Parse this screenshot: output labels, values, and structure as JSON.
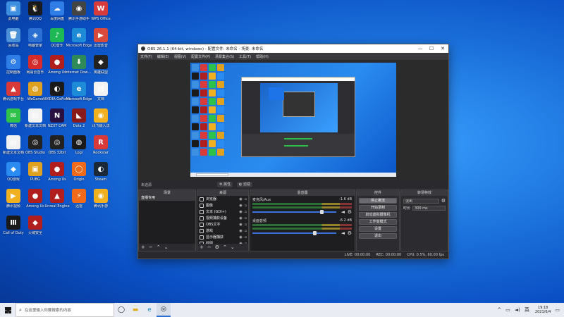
{
  "desktop": {
    "icons": [
      {
        "label": "此电脑",
        "color": "#3d8fe0",
        "glyph": "▣"
      },
      {
        "label": "腾讯QQ",
        "color": "#1a1a1a",
        "glyph": "🐧"
      },
      {
        "label": "百度网盘",
        "color": "#2f7ee8",
        "glyph": "☁"
      },
      {
        "label": "腾讯手游助手",
        "color": "#444",
        "glyph": "◉"
      },
      {
        "label": "WPS Office",
        "color": "#d83b3b",
        "glyph": "W"
      },
      {
        "label": "回收站",
        "color": "#4a90d9",
        "glyph": "🗑"
      },
      {
        "label": "电脑管家",
        "color": "#2a6fd1",
        "glyph": "◈"
      },
      {
        "label": "QQ音乐",
        "color": "#1db954",
        "glyph": "♪"
      },
      {
        "label": "Microsoft Edge",
        "color": "#1d8bd6",
        "glyph": "e"
      },
      {
        "label": "迅雷影音",
        "color": "#d84a3b",
        "glyph": "▶"
      },
      {
        "label": "控制面板",
        "color": "#2f7ee8",
        "glyph": "⚙"
      },
      {
        "label": "网易云音乐",
        "color": "#d62b2b",
        "glyph": "◎"
      },
      {
        "label": "Among Us",
        "color": "#b01e1e",
        "glyph": "●"
      },
      {
        "label": "Internet Download",
        "color": "#2e8b57",
        "glyph": "⬇"
      },
      {
        "label": "英雄联盟",
        "color": "#222",
        "glyph": "◆"
      },
      {
        "label": "腾讯游戏平台",
        "color": "#d83a3a",
        "glyph": "▲"
      },
      {
        "label": "WeGame",
        "color": "#e0a020",
        "glyph": "◍"
      },
      {
        "label": "NVIDIA GeForce",
        "color": "#1a1a1a",
        "glyph": "◐"
      },
      {
        "label": "Microsoft Edge",
        "color": "#1d8bd6",
        "glyph": "e"
      },
      {
        "label": "文档",
        "color": "#f2f2f2",
        "glyph": "▤"
      },
      {
        "label": "微信",
        "color": "#2ec24a",
        "glyph": "✉"
      },
      {
        "label": "新建文本文档",
        "color": "#f2f2f2",
        "glyph": "▤"
      },
      {
        "label": "NZXT CAM",
        "color": "#2a1040",
        "glyph": "N"
      },
      {
        "label": "Dota 2",
        "color": "#8a1a1a",
        "glyph": "◣"
      },
      {
        "label": "讯飞输入法",
        "color": "#f0b020",
        "glyph": "◉"
      },
      {
        "label": "新建文本文档",
        "color": "#f2f2f2",
        "glyph": "▤"
      },
      {
        "label": "OBS Studio",
        "color": "#222",
        "glyph": "◎"
      },
      {
        "label": "OBS 32bit",
        "color": "#222",
        "glyph": "◎"
      },
      {
        "label": "Logi",
        "color": "#1a1a1a",
        "glyph": "◍"
      },
      {
        "label": "Rockstar",
        "color": "#d83a3a",
        "glyph": "R"
      },
      {
        "label": "QQ游戏",
        "color": "#2a8cf0",
        "glyph": "◆"
      },
      {
        "label": "PUBG",
        "color": "#e0a020",
        "glyph": "▣"
      },
      {
        "label": "Among Us",
        "color": "#b01e1e",
        "glyph": "●"
      },
      {
        "label": "Origin",
        "color": "#f06a1a",
        "glyph": "◯"
      },
      {
        "label": "Steam",
        "color": "#1b2838",
        "glyph": "◐"
      },
      {
        "label": "腾讯视频",
        "color": "#f0b020",
        "glyph": "▶"
      },
      {
        "label": "Among Us",
        "color": "#b01e1e",
        "glyph": "●"
      },
      {
        "label": "Unreal Engine",
        "color": "#b01e1e",
        "glyph": "▲"
      },
      {
        "label": "迅雷",
        "color": "#f06a1a",
        "glyph": "⚡"
      },
      {
        "label": "腾讯手游",
        "color": "#f0b020",
        "glyph": "◉"
      },
      {
        "label": "Call of Duty",
        "color": "#1a1a1a",
        "glyph": "Ⅲ"
      },
      {
        "label": "火绒安全",
        "color": "#b01e1e",
        "glyph": "◆"
      }
    ]
  },
  "obs": {
    "title": "OBS 26.1.1 (64-bit, windows) - 配置文件: 未命名 - 场景: 未命名",
    "window_buttons": {
      "minimize": "—",
      "maximize": "☐",
      "close": "✕"
    },
    "menu": [
      "文件(F)",
      "编辑(E)",
      "视图(V)",
      "配置文件(P)",
      "场景集合(S)",
      "工具(T)",
      "帮助(H)"
    ],
    "no_source_label": "未选源",
    "preview_tabs": [
      "属性",
      "滤镜"
    ],
    "scenes": {
      "header": "场景",
      "items": [
        "直播专用"
      ]
    },
    "sources": {
      "header": "来源",
      "items": [
        "浏览器",
        "图像",
        "文本 (GDI+)",
        "视频捕获设备",
        "OBS文字",
        "游戏",
        "显示器捕获",
        "截图"
      ]
    },
    "mixer": {
      "header": "混音器",
      "channels": [
        {
          "name": "麦克风/Aux",
          "db": "-1.6 dB",
          "level": 0.82
        },
        {
          "name": "桌面音频",
          "db": "-6.2 dB",
          "level": 0.74
        }
      ]
    },
    "transitions": {
      "header": "转场特效",
      "type_label": "淡出",
      "duration_label": "时长",
      "duration_value": "300 ms"
    },
    "controls": {
      "header": "控件",
      "buttons": [
        "停止推流",
        "开始录制",
        "启动虚拟摄像机",
        "工作室模式",
        "设置",
        "退出"
      ]
    },
    "footer_buttons": [
      "+",
      "−",
      "⌃",
      "⌄"
    ],
    "status": {
      "live": "LIVE: 00:00:00",
      "rec": "REC: 00:00:00",
      "cpu": "CPU: 0.5%, 60.00 fps"
    }
  },
  "taskbar": {
    "search_placeholder": "在这里输入你要搜索的内容",
    "time": "19:18",
    "date": "2021/6/4",
    "language": "英"
  }
}
